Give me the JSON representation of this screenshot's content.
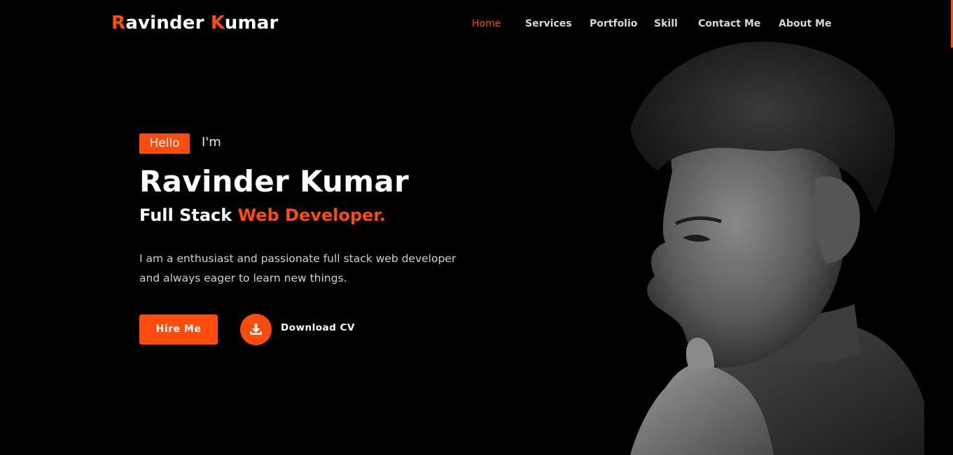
{
  "header": {
    "logo": {
      "first_initial": "R",
      "first_rest": "avinder ",
      "last_initial": "K",
      "last_rest": "umar"
    },
    "nav": [
      {
        "label": "Home",
        "active": true
      },
      {
        "label": "Services",
        "active": false
      },
      {
        "label": "Portfolio",
        "active": false
      },
      {
        "label": "Skill",
        "active": false
      },
      {
        "label": "Contact Me",
        "active": false
      },
      {
        "label": "About Me",
        "active": false
      }
    ]
  },
  "hero": {
    "badge": "Hello",
    "intro": "I'm",
    "name": "Ravinder Kumar",
    "role_prefix": "Full Stack ",
    "role_highlight": "Web Developer.",
    "description_line1": "I am a enthusiast and passionate full stack web developer",
    "description_line2": "and always eager to learn new things.",
    "hire_button": "Hire Me",
    "download_label": "Download CV"
  },
  "icons": {
    "download": "download-icon"
  },
  "colors": {
    "accent": "#ff4b0c",
    "background": "#000000",
    "text": "#ffffff"
  }
}
